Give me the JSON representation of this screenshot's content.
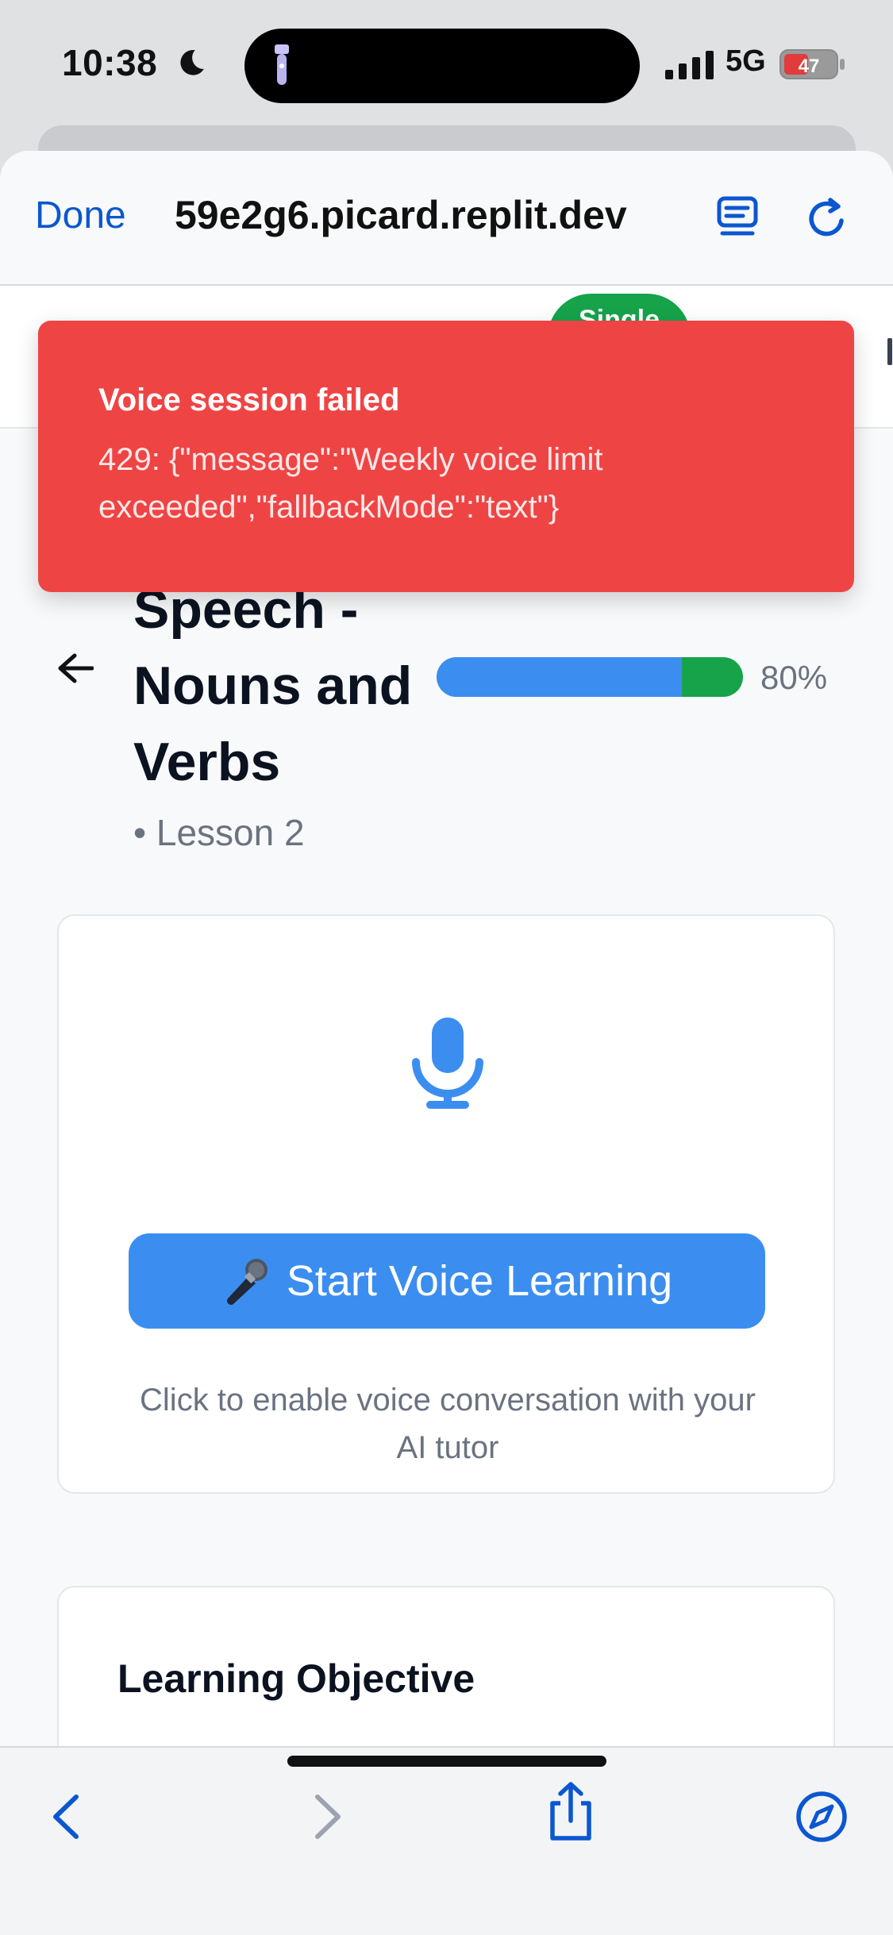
{
  "status_bar": {
    "time": "10:38",
    "network": "5G",
    "battery": "47"
  },
  "browser": {
    "done_label": "Done",
    "url": "59e2g6.picard.replit.dev"
  },
  "app_header": {
    "mode_pill": "Single"
  },
  "toast": {
    "title": "Voice session failed",
    "message": "429: {\"message\":\"Weekly voice limit exceeded\",\"fallbackMode\":\"text\"}"
  },
  "lesson": {
    "title": "Speech - Nouns and Verbs",
    "subtitle": "• Lesson 2",
    "progress_percent": 80,
    "progress_label": "80%",
    "progress_colors": {
      "fill": "#3b8ef0",
      "track": "#16a34a"
    }
  },
  "voice_card": {
    "button_label": "Start Voice Learning",
    "hint": "Click to enable voice conversation with your AI tutor"
  },
  "objective_card": {
    "title": "Learning Objective"
  },
  "toolbar": {
    "icons": [
      "back-icon",
      "forward-icon",
      "share-icon",
      "compass-icon"
    ]
  },
  "colors": {
    "accent": "#3b8ef0",
    "error": "#ef4444",
    "success": "#16a34a",
    "link": "#0b57d0"
  }
}
